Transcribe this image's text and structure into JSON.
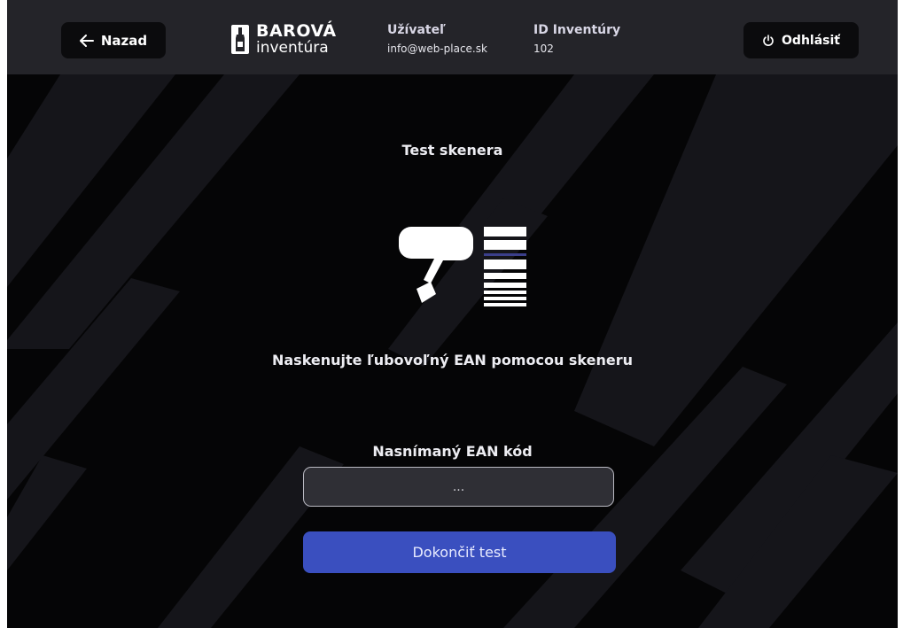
{
  "header": {
    "back_label": "Nazad",
    "logo_line1": "BAROVÁ",
    "logo_line2": "inventúra",
    "user_label": "Užívateľ",
    "user_value": "info@web-place.sk",
    "inventory_label": "ID Inventúry",
    "inventory_value": "102",
    "logout_label": "Odhlásiť",
    "icons": {
      "back": "arrow-left-icon",
      "logout": "power-icon",
      "logo": "bottle-logo-icon"
    }
  },
  "main": {
    "title": "Test skenera",
    "instruction": "Naskenujte ľubovoľný EAN pomocou skeneru",
    "ean_label": "Nasnímaný EAN kód",
    "ean_value": "",
    "ean_placeholder": "...",
    "finish_label": "Dokončiť test",
    "illustration": "barcode-scanner-icon"
  },
  "colors": {
    "topbar": "#242429",
    "background": "#050506",
    "stripe": "#16161b",
    "accent": "#3a4fbf"
  }
}
